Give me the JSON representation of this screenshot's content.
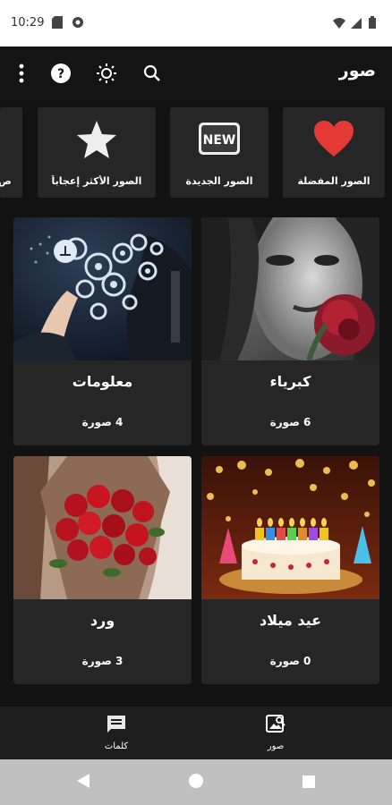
{
  "status_bar": {
    "time": "10:29",
    "left_icons": [
      "sd-card-icon",
      "shield-icon"
    ],
    "right_icons": [
      "wifi-icon",
      "signal-icon",
      "battery-icon"
    ]
  },
  "app_bar": {
    "title": "صور",
    "actions": [
      "search-icon",
      "brightness-icon",
      "help-icon",
      "more-vert-icon"
    ]
  },
  "categories": [
    {
      "label": "الصور المفضلة",
      "icon": "heart-icon"
    },
    {
      "label": "الصور الجديدة",
      "icon": "new-badge-icon",
      "badge": "NEW"
    },
    {
      "label": "الصور الأكثر إعجاباً",
      "icon": "star-icon"
    },
    {
      "label": "ص",
      "icon": ""
    }
  ],
  "grid": [
    {
      "title": "كبرياء",
      "count": "6 صورة",
      "image": "woman-with-rose"
    },
    {
      "title": "معلومات",
      "count": "4 صورة",
      "image": "business-gears"
    },
    {
      "title": "عيد ميلاد",
      "count": "0 صورة",
      "image": "birthday-cake"
    },
    {
      "title": "ورد",
      "count": "3 صورة",
      "image": "red-roses-bouquet"
    }
  ],
  "bottom_nav": [
    {
      "label": "صور",
      "icon": "image-search-icon"
    },
    {
      "label": "كلمات",
      "icon": "message-icon"
    }
  ],
  "colors": {
    "background": "#121212",
    "card": "#262626",
    "heart": "#e53935"
  }
}
